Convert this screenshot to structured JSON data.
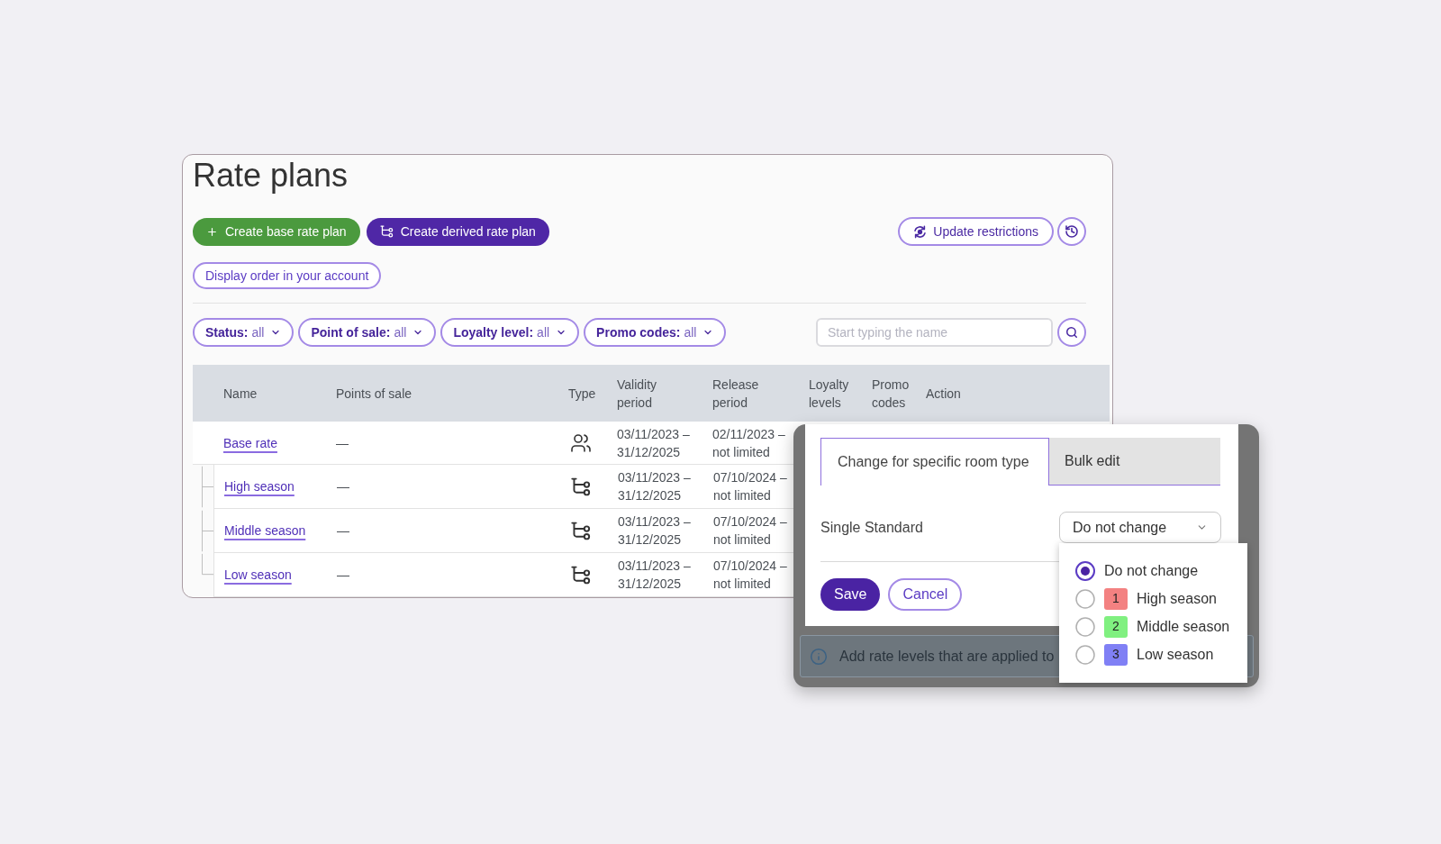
{
  "page": {
    "title": "Rate plans"
  },
  "actions": {
    "create_base": "Create base rate plan",
    "create_derived": "Create derived rate plan",
    "update_restrictions": "Update restrictions",
    "display_order": "Display order in your account"
  },
  "filters": [
    {
      "label": "Status:",
      "value": "all"
    },
    {
      "label": "Point of sale:",
      "value": "all"
    },
    {
      "label": "Loyalty level:",
      "value": "all"
    },
    {
      "label": "Promo codes:",
      "value": "all"
    }
  ],
  "search": {
    "placeholder": "Start typing the name"
  },
  "table": {
    "columns": [
      "Name",
      "Points of sale",
      "Type",
      "Validity period",
      "Release period",
      "Loyalty levels",
      "Promo codes",
      "Action"
    ],
    "rows": [
      {
        "name": "Base rate",
        "points_of_sale": "—",
        "validity": "03/11/2023 – 31/12/2025",
        "release": "02/11/2023 – not limited",
        "children": [
          {
            "name": "High season",
            "points_of_sale": "—",
            "validity": "03/11/2023 – 31/12/2025",
            "release": "07/10/2024 – not limited"
          },
          {
            "name": "Middle season",
            "points_of_sale": "—",
            "validity": "03/11/2023 – 31/12/2025",
            "release": "07/10/2024 – not limited"
          },
          {
            "name": "Low season",
            "points_of_sale": "—",
            "validity": "03/11/2023 – 31/12/2025",
            "release": "07/10/2024 – not limited"
          }
        ]
      }
    ]
  },
  "overlay": {
    "tabs": [
      {
        "label": "Change for specific room type",
        "selected": true
      },
      {
        "label": "Bulk edit",
        "selected": false
      }
    ],
    "field": {
      "label": "Single Standard",
      "value": "Do not change"
    },
    "buttons": [
      {
        "kind": "primary",
        "label": "Save"
      },
      {
        "kind": "secondary",
        "label": "Cancel"
      }
    ],
    "options": [
      {
        "label": "Do not change",
        "selected": true
      },
      {
        "badge": "1",
        "color": "#f38181",
        "label": "High season",
        "selected": false
      },
      {
        "badge": "2",
        "color": "#80f080",
        "label": "Middle season",
        "selected": false
      },
      {
        "badge": "3",
        "color": "#8080f5",
        "label": "Low season",
        "selected": false
      }
    ],
    "info": {
      "text": "Add rate levels that are applied to"
    }
  }
}
